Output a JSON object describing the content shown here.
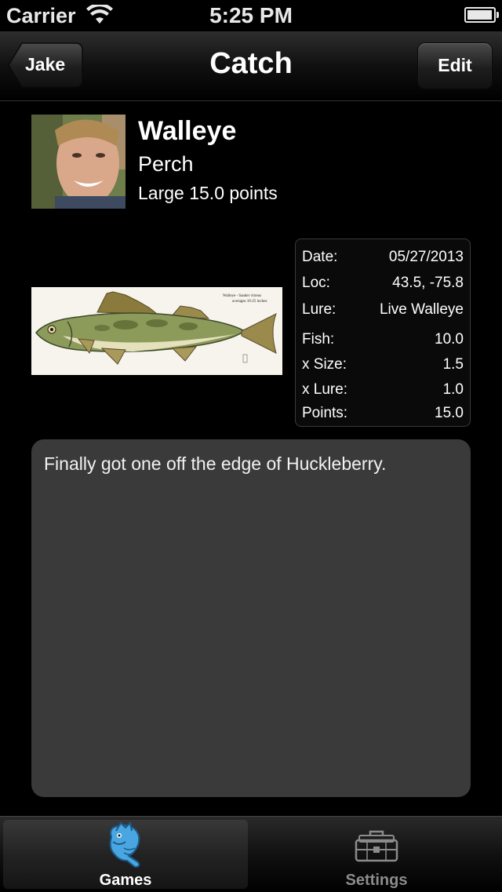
{
  "status_bar": {
    "carrier": "Carrier",
    "time": "5:25 PM"
  },
  "nav": {
    "back_label": "Jake",
    "title": "Catch",
    "edit_label": "Edit"
  },
  "catch": {
    "species": "Walleye",
    "subspecies": "Perch",
    "size_points": "Large 15.0 points"
  },
  "fish_image": {
    "caption_title": "Walleye - Sander vitreus",
    "caption_sub": "averages 10-25 inches"
  },
  "stats": [
    {
      "label": "Date:",
      "value": "05/27/2013"
    },
    {
      "label": "Loc:",
      "value": "43.5, -75.8"
    },
    {
      "label": "Lure:",
      "value": "Live Walleye"
    },
    {
      "label": "Fish:",
      "value": "10.0"
    },
    {
      "label": "x Size:",
      "value": "1.5"
    },
    {
      "label": "x Lure:",
      "value": "1.0"
    },
    {
      "label": "Points:",
      "value": "15.0"
    }
  ],
  "notes": "Finally got one off the edge of Huckleberry.",
  "tabs": [
    {
      "label": "Games",
      "icon": "fish-icon",
      "selected": true
    },
    {
      "label": "Settings",
      "icon": "tackle-box-icon",
      "selected": false
    }
  ]
}
